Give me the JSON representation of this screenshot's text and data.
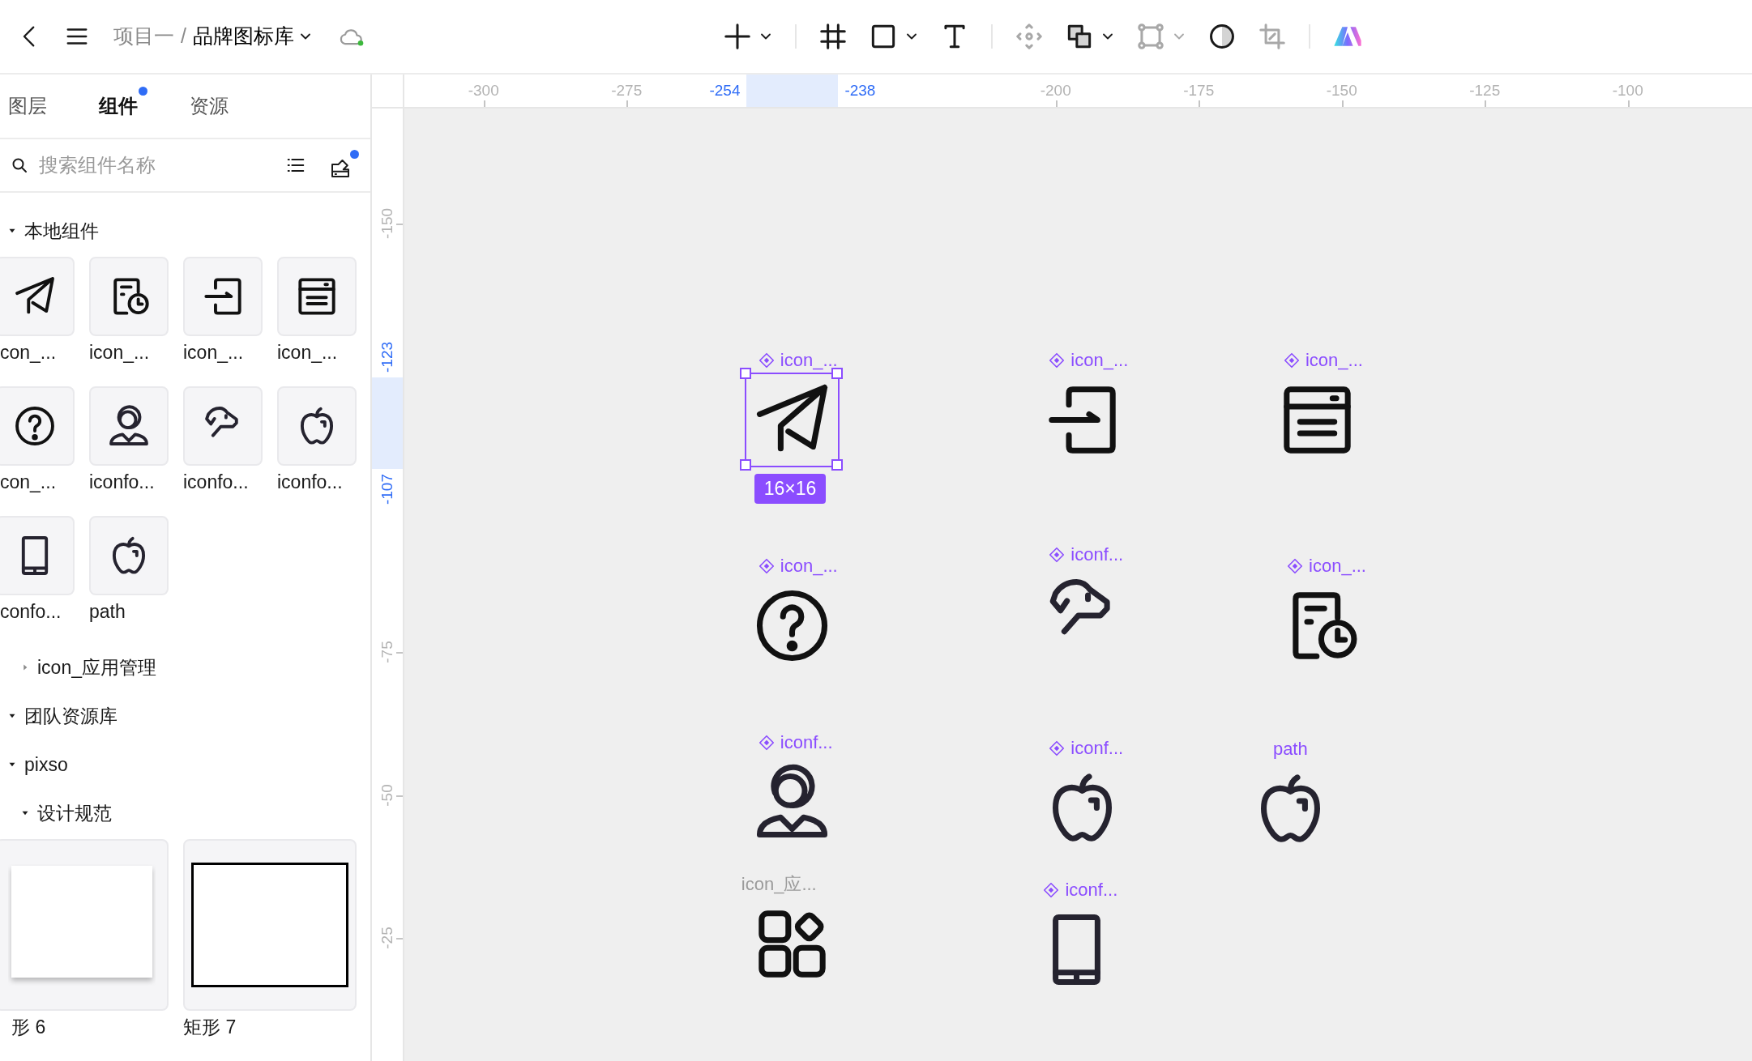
{
  "topbar": {
    "breadcrumb": [
      "项目一",
      "品牌图标库"
    ],
    "separator": "/",
    "synced": true
  },
  "tools": [
    {
      "disabled": false,
      "dropdown": true
    },
    {
      "disabled": false,
      "dropdown": false
    },
    {
      "disabled": false,
      "dropdown": true
    },
    {
      "disabled": false,
      "dropdown": false
    },
    {
      "disabled": true,
      "dropdown": false
    },
    {
      "disabled": false,
      "dropdown": true
    },
    {
      "disabled": true,
      "dropdown": true
    },
    {
      "disabled": false,
      "dropdown": false
    },
    {
      "disabled": true,
      "dropdown": false
    }
  ],
  "panel": {
    "tabs": [
      {
        "label": "图层",
        "selected": false,
        "notification": false
      },
      {
        "label": "组件",
        "selected": true,
        "notification": true
      },
      {
        "label": "资源",
        "selected": false,
        "notification": false
      }
    ],
    "search": {
      "placeholder": "搜索组件名称"
    },
    "library_notification": true,
    "tree": [
      {
        "label": "本地组件",
        "kind": "section",
        "expanded": true,
        "components": [
          {
            "label": "con_..."
          },
          {
            "label": "icon_..."
          },
          {
            "label": "icon_..."
          },
          {
            "label": "icon_..."
          },
          {
            "label": "con_..."
          },
          {
            "label": "iconfo..."
          },
          {
            "label": "iconfo..."
          },
          {
            "label": "iconfo..."
          },
          {
            "label": "confo..."
          },
          {
            "label": "path"
          }
        ],
        "children": [
          {
            "label": "icon_应用管理",
            "kind": "group",
            "expanded": false
          }
        ]
      },
      {
        "label": "团队资源库",
        "kind": "section",
        "expanded": true,
        "children": [
          {
            "label": "pixso",
            "kind": "section",
            "expanded": true,
            "children": [
              {
                "label": "设计规范",
                "kind": "group",
                "expanded": true,
                "components": [
                  {
                    "label": "形 6"
                  },
                  {
                    "label": "矩形 7"
                  }
                ]
              }
            ]
          }
        ]
      }
    ]
  },
  "rulers": {
    "horizontal": [
      {
        "label": "-300",
        "kind": "normal"
      },
      {
        "label": "-275",
        "kind": "normal"
      },
      {
        "label": "-254",
        "kind": "highlight"
      },
      {
        "label": "-238",
        "kind": "highlight"
      },
      {
        "label": "-200",
        "kind": "normal"
      },
      {
        "label": "-175",
        "kind": "normal"
      },
      {
        "label": "-150",
        "kind": "normal"
      },
      {
        "label": "-125",
        "kind": "normal"
      },
      {
        "label": "-100",
        "kind": "normal"
      }
    ],
    "vertical": [
      {
        "label": "-150",
        "kind": "normal"
      },
      {
        "label": "-123",
        "kind": "highlight"
      },
      {
        "label": "-107",
        "kind": "highlight"
      },
      {
        "label": "-75",
        "kind": "normal"
      },
      {
        "label": "-50",
        "kind": "normal"
      },
      {
        "label": "-25",
        "kind": "normal"
      }
    ]
  },
  "canvas": {
    "items": [
      {
        "label": "icon_...",
        "kind": "component",
        "selected": true,
        "size": "16×16"
      },
      {
        "label": "icon_...",
        "kind": "component",
        "selected": false
      },
      {
        "label": "icon_...",
        "kind": "component",
        "selected": false
      },
      {
        "label": "icon_...",
        "kind": "component",
        "selected": false
      },
      {
        "label": "iconf...",
        "kind": "component",
        "selected": false
      },
      {
        "label": "icon_...",
        "kind": "component",
        "selected": false
      },
      {
        "label": "iconf...",
        "kind": "component",
        "selected": false
      },
      {
        "label": "iconf...",
        "kind": "component",
        "selected": false
      },
      {
        "label": "path",
        "kind": "path",
        "selected": false
      },
      {
        "label": "icon_应...",
        "kind": "group",
        "selected": false
      },
      {
        "label": "iconf...",
        "kind": "component",
        "selected": false
      }
    ]
  }
}
